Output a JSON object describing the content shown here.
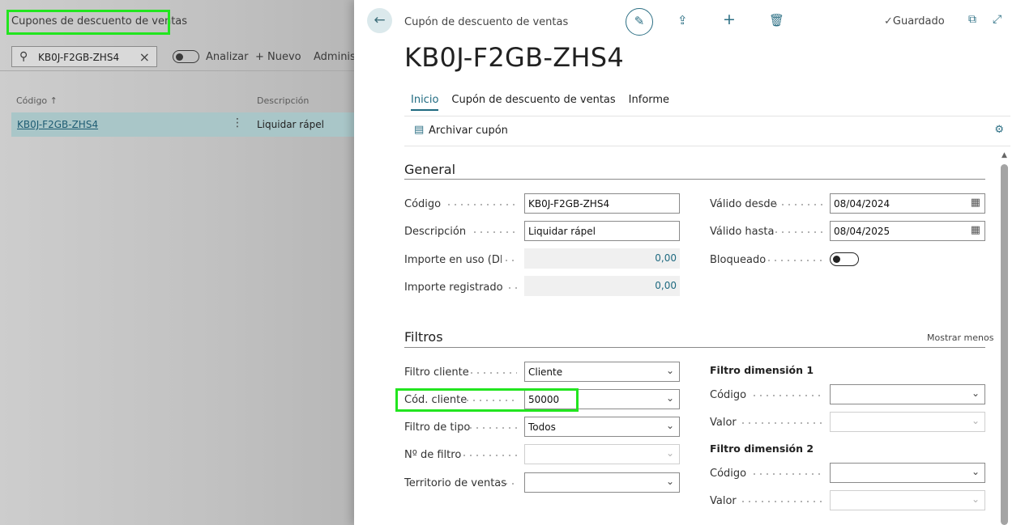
{
  "list_page": {
    "title": "Cupones de descuento de ventas",
    "search_value": "KB0J-F2GB-ZHS4",
    "analyze_label": "Analizar",
    "new_label": "Nuevo",
    "admin_label": "Administ",
    "columns": {
      "code": "Código ↑",
      "description": "Descripción"
    },
    "row": {
      "code": "KB0J-F2GB-ZHS4",
      "description": "Liquidar rápel"
    }
  },
  "card": {
    "caption": "Cupón de descuento de ventas",
    "title": "KB0J-F2GB-ZHS4",
    "saved_label": "Guardado",
    "tabs": [
      "Inicio",
      "Cupón de descuento de ventas",
      "Informe"
    ],
    "actions": {
      "archive_label": "Archivar cupón"
    },
    "general": {
      "title": "General",
      "codigo": {
        "label": "Código",
        "value": "KB0J-F2GB-ZHS4"
      },
      "descripcion": {
        "label": "Descripción",
        "value": "Liquidar rápel"
      },
      "importe_uso": {
        "label": "Importe en uso (DL)",
        "value": "0,00"
      },
      "importe_registrado": {
        "label": "Importe registrado (...",
        "value": "0,00"
      },
      "valido_desde": {
        "label": "Válido desde",
        "value": "08/04/2024"
      },
      "valido_hasta": {
        "label": "Válido hasta",
        "value": "08/04/2025"
      },
      "bloqueado": {
        "label": "Bloqueado"
      }
    },
    "filtros": {
      "title": "Filtros",
      "show_less": "Mostrar menos",
      "filtro_cliente": {
        "label": "Filtro cliente",
        "value": "Cliente"
      },
      "cod_cliente": {
        "label": "Cód. cliente",
        "value": "50000"
      },
      "filtro_tipo": {
        "label": "Filtro de tipo",
        "value": "Todos"
      },
      "num_filtro": {
        "label": "Nº de filtro",
        "value": ""
      },
      "territorio": {
        "label": "Territorio de ventas",
        "value": ""
      },
      "dim1": {
        "title": "Filtro dimensión 1",
        "codigo_label": "Código",
        "valor_label": "Valor"
      },
      "dim2": {
        "title": "Filtro dimensión 2",
        "codigo_label": "Código",
        "valor_label": "Valor"
      }
    }
  },
  "colors": {
    "accent": "#1f6a80",
    "highlight": "#22e51f",
    "selected_row": "#a9c6c8"
  }
}
